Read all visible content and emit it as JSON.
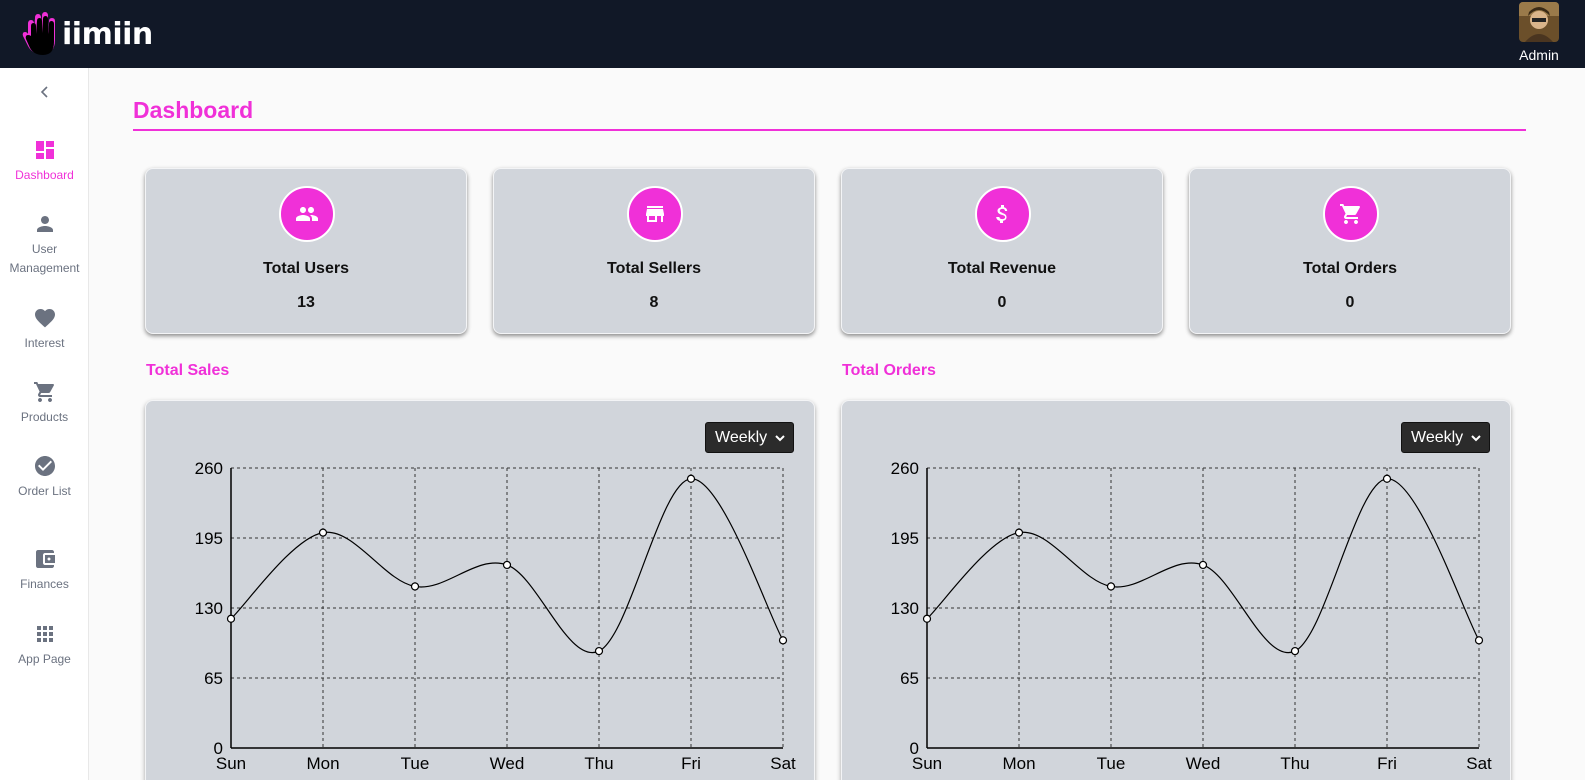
{
  "app": {
    "brand": "iimiin",
    "user": {
      "name": "Admin"
    }
  },
  "sidebar": {
    "items": [
      {
        "label": "Dashboard",
        "icon": "dashboard-icon",
        "active": true
      },
      {
        "label": "User Management",
        "icon": "user-icon",
        "active": false
      },
      {
        "label": "Interest",
        "icon": "heart-icon",
        "active": false
      },
      {
        "label": "Products",
        "icon": "cart-icon",
        "active": false
      },
      {
        "label": "Order List",
        "icon": "check-circle-icon",
        "active": false
      },
      {
        "label": "Finances",
        "icon": "wallet-icon",
        "active": false
      },
      {
        "label": "App Page",
        "icon": "grid-icon",
        "active": false
      }
    ]
  },
  "page": {
    "title": "Dashboard"
  },
  "stats": [
    {
      "label": "Total Users",
      "value": "13",
      "icon": "users-icon"
    },
    {
      "label": "Total Sellers",
      "value": "8",
      "icon": "store-icon"
    },
    {
      "label": "Total Revenue",
      "value": "0",
      "icon": "dollar-icon"
    },
    {
      "label": "Total Orders",
      "value": "0",
      "icon": "cart-icon"
    }
  ],
  "charts": {
    "sales": {
      "title": "Total Sales",
      "period": "Weekly"
    },
    "orders": {
      "title": "Total Orders",
      "period": "Weekly"
    }
  },
  "colors": {
    "accent": "#f030d8",
    "topbar": "#111827",
    "card": "#d1d5db"
  },
  "chart_data": [
    {
      "type": "line",
      "title": "Total Sales",
      "categories": [
        "Sun",
        "Mon",
        "Tue",
        "Wed",
        "Thu",
        "Fri",
        "Sat"
      ],
      "values": [
        120,
        200,
        150,
        170,
        90,
        250,
        100
      ],
      "ylim": [
        0,
        260
      ],
      "yticks": [
        0,
        65,
        130,
        195,
        260
      ],
      "grid": true
    },
    {
      "type": "line",
      "title": "Total Orders",
      "categories": [
        "Sun",
        "Mon",
        "Tue",
        "Wed",
        "Thu",
        "Fri",
        "Sat"
      ],
      "values": [
        120,
        200,
        150,
        170,
        90,
        250,
        100
      ],
      "ylim": [
        0,
        260
      ],
      "yticks": [
        0,
        65,
        130,
        195,
        260
      ],
      "grid": true
    }
  ]
}
